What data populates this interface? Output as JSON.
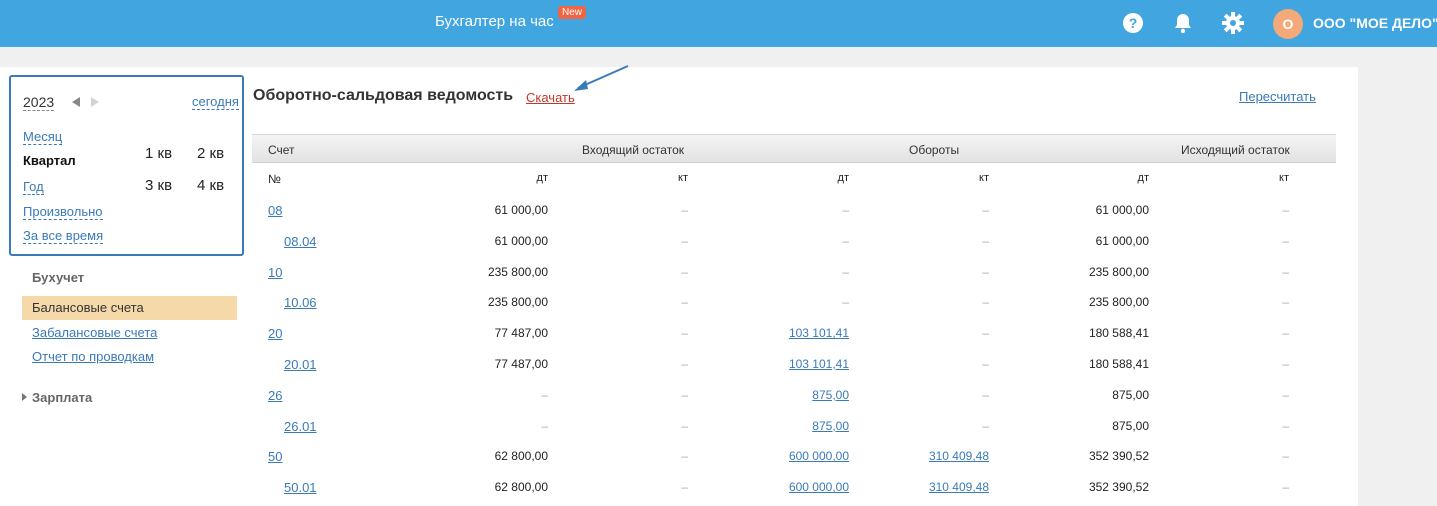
{
  "header": {
    "title": "Бухгалтер на час",
    "badge": "New",
    "avatar_letter": "О",
    "org_name": "ООО \"МОЕ ДЕЛО\"",
    "bg_color": "#41a5e0"
  },
  "calendar": {
    "year": "2023",
    "today": "сегодня",
    "options": [
      "Месяц",
      "Квартал",
      "Год",
      "Произвольно",
      "За все время"
    ],
    "selected": "Квартал",
    "quarters": [
      "1 кв",
      "2 кв",
      "3 кв",
      "4 кв"
    ]
  },
  "nav": {
    "heading1": "Бухучет",
    "items": [
      "Балансовые счета",
      "Забалансовые счета",
      "Отчет по проводкам"
    ],
    "selected": "Балансовые счета",
    "heading2": "Зарплата"
  },
  "report": {
    "title": "Оборотно-сальдовая ведомость",
    "download": "Скачать",
    "recalc": "Пересчитать",
    "headers": [
      "Счет",
      "Входящий остаток",
      "Обороты",
      "Исходящий остаток"
    ],
    "subheaders": [
      "№",
      "дт",
      "кт",
      "дт",
      "кт",
      "дт",
      "кт"
    ],
    "rows": [
      {
        "acc": "08",
        "sub": false,
        "v": [
          "61 000,00",
          "–",
          "–",
          "–",
          "61 000,00",
          "–"
        ]
      },
      {
        "acc": "08.04",
        "sub": true,
        "v": [
          "61 000,00",
          "–",
          "–",
          "–",
          "61 000,00",
          "–"
        ]
      },
      {
        "acc": "10",
        "sub": false,
        "v": [
          "235 800,00",
          "–",
          "–",
          "–",
          "235 800,00",
          "–"
        ]
      },
      {
        "acc": "10.06",
        "sub": true,
        "v": [
          "235 800,00",
          "–",
          "–",
          "–",
          "235 800,00",
          "–"
        ]
      },
      {
        "acc": "20",
        "sub": false,
        "v": [
          "77 487,00",
          "–",
          "103 101,41",
          "–",
          "180 588,41",
          "–"
        ]
      },
      {
        "acc": "20.01",
        "sub": true,
        "v": [
          "77 487,00",
          "–",
          "103 101,41",
          "–",
          "180 588,41",
          "–"
        ]
      },
      {
        "acc": "26",
        "sub": false,
        "v": [
          "–",
          "–",
          "875,00",
          "–",
          "875,00",
          "–"
        ]
      },
      {
        "acc": "26.01",
        "sub": true,
        "v": [
          "–",
          "–",
          "875,00",
          "–",
          "875,00",
          "–"
        ]
      },
      {
        "acc": "50",
        "sub": false,
        "v": [
          "62 800,00",
          "–",
          "600 000,00",
          "310 409,48",
          "352 390,52",
          "–"
        ]
      },
      {
        "acc": "50.01",
        "sub": true,
        "v": [
          "62 800,00",
          "–",
          "600 000,00",
          "310 409,48",
          "352 390,52",
          "–"
        ]
      }
    ]
  }
}
